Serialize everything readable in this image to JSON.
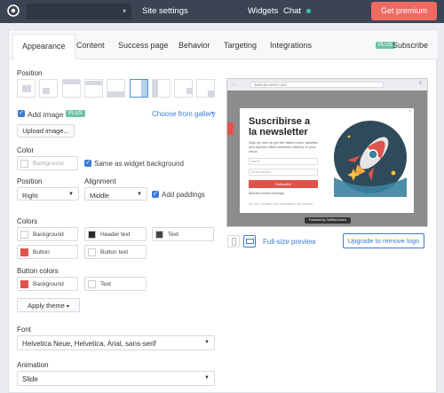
{
  "topbar": {
    "site_title": "Site settings",
    "widgets": "Widgets",
    "chat": "Chat",
    "premium": "Get premium"
  },
  "tabs": [
    {
      "label": "Appearance"
    },
    {
      "label": "Content"
    },
    {
      "label": "Success page"
    },
    {
      "label": "Behavior"
    },
    {
      "label": "Targeting"
    },
    {
      "label": "Integrations"
    }
  ],
  "subscribe": {
    "badge": "PLUS",
    "label": "Subscribe"
  },
  "position": {
    "label": "Position",
    "selected_index": 5
  },
  "image": {
    "add_label": "Add image",
    "badge": "PLUS",
    "gallery": "Choose from gallery",
    "upload": "Upload image..."
  },
  "color": {
    "label": "Color",
    "placeholder": "Background",
    "same_as": "Same as widget background"
  },
  "layout": {
    "position_label": "Position",
    "position_value": "Right",
    "alignment_label": "Alignment",
    "alignment_value": "Middle",
    "paddings": "Add paddings"
  },
  "colors": {
    "label": "Colors",
    "background": "Background",
    "header_text": "Header text",
    "text": "Text",
    "button": "Button",
    "button_text": "Button text",
    "header_swatch": "#2b2b2b",
    "text_swatch": "#444444",
    "button_swatch": "#e0534b"
  },
  "button_colors": {
    "label": "Button colors",
    "background": "Background",
    "text": "Text",
    "bg_swatch": "#e0534b"
  },
  "apply_theme": "Apply theme",
  "font": {
    "label": "Font",
    "value": "Helvetica Neue, Helvetica, Arial, sans-serif"
  },
  "animation": {
    "label": "Animation",
    "value": "Slide"
  },
  "preview": {
    "url": "www.jscontes.com",
    "title": "Suscribirse a la newsletter",
    "desc": "Sign up here to get the latest news, updates and special offers delivered directly to your inbox.",
    "name_placeholder": "Name",
    "email_placeholder": "Email address",
    "button": "Subscribe",
    "consent": "Specify consent message",
    "privacy": "We will not share your information with anyone",
    "powered": "Powered by GetSiteControl",
    "fullsize": "Full-size preview",
    "remove_logo": "Upgrade to remove logo"
  }
}
